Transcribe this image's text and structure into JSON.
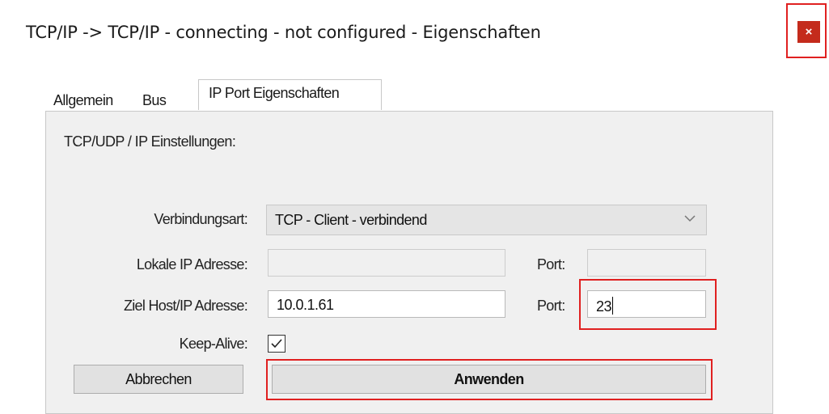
{
  "window": {
    "title": "TCP/IP -> TCP/IP - connecting - not configured - Eigenschaften",
    "close_label": "×",
    "close_icon": "close-icon",
    "highlight_color": "#e02020"
  },
  "tabs": [
    {
      "label": "Allgemein",
      "active": false
    },
    {
      "label": "Bus",
      "active": false
    },
    {
      "label": "IP Port Eigenschaften",
      "active": true
    }
  ],
  "section": {
    "label": "TCP/UDP / IP Einstellungen:"
  },
  "form": {
    "connection_type": {
      "label": "Verbindungsart:",
      "value": "TCP - Client - verbindend",
      "icon": "chevron-down-icon"
    },
    "local_ip": {
      "label": "Lokale IP Adresse:",
      "value": "",
      "port_label": "Port:",
      "port_value": ""
    },
    "target_host": {
      "label": "Ziel Host/IP Adresse:",
      "value": "10.0.1.61",
      "port_label": "Port:",
      "port_value": "23"
    },
    "keep_alive": {
      "label": "Keep-Alive:",
      "checked": true,
      "icon": "checkmark-icon"
    }
  },
  "buttons": {
    "cancel": "Abbrechen",
    "apply": "Anwenden"
  }
}
